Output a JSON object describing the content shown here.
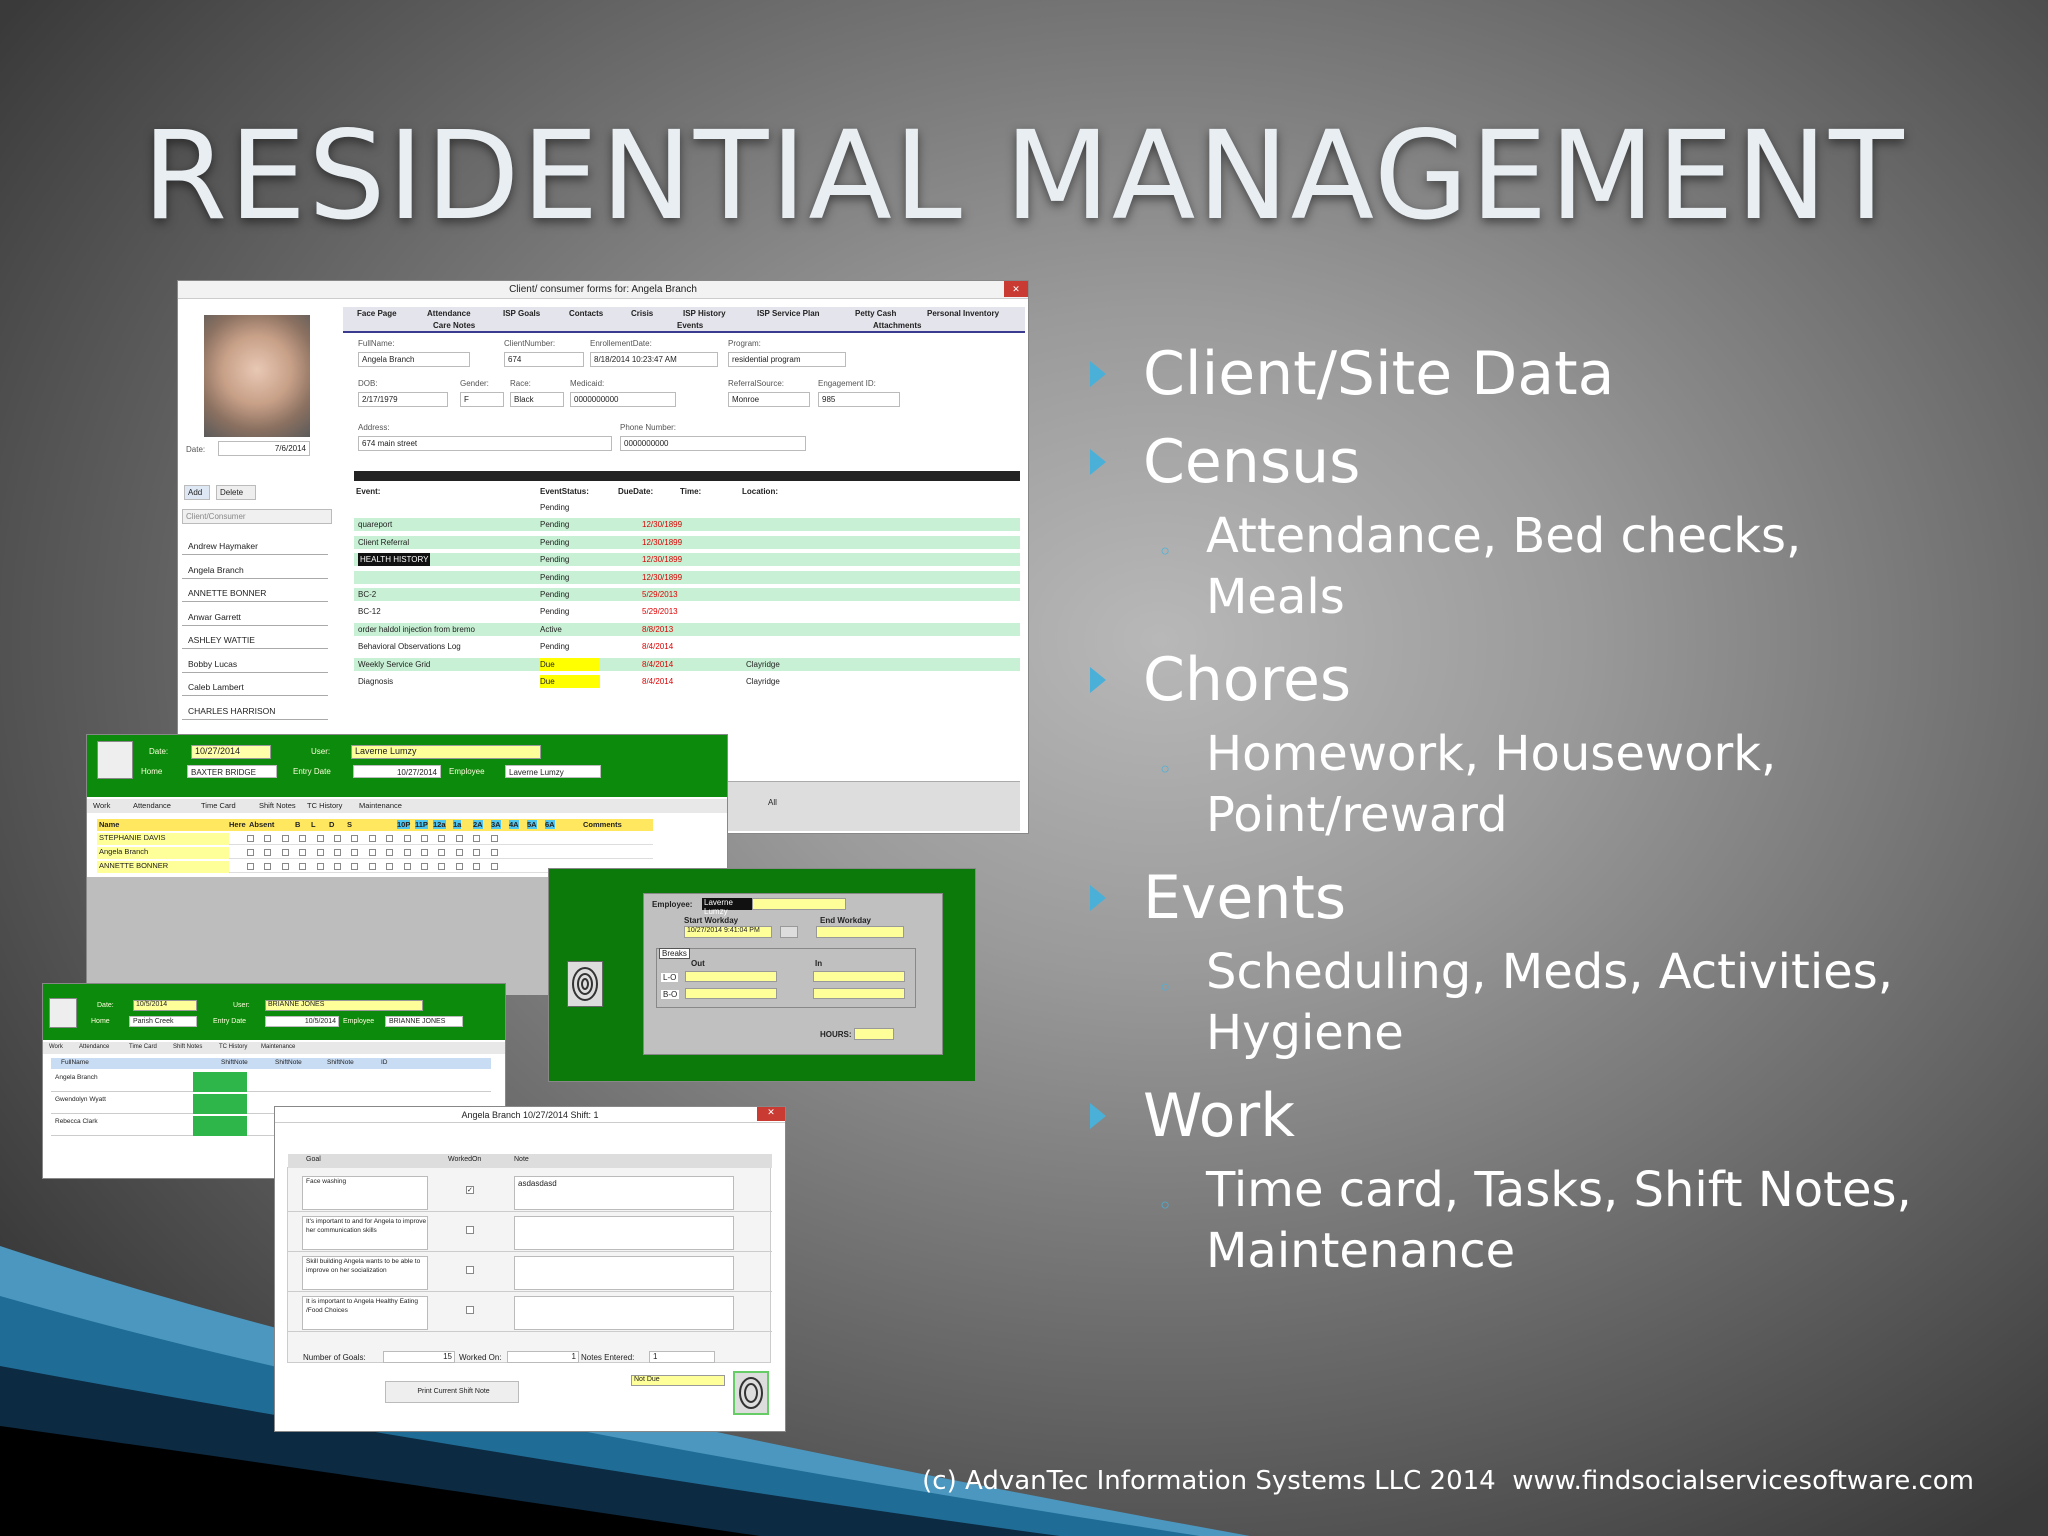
{
  "slide": {
    "title": "RESIDENTIAL MANAGEMENT",
    "footer": "(c) AdvanTec Information Systems LLC 2014  www.findsocialservicesoftware.com"
  },
  "bullets": [
    {
      "label": "Client/Site Data",
      "subs": []
    },
    {
      "label": "Census",
      "subs": [
        "Attendance, Bed checks, Meals"
      ]
    },
    {
      "label": "Chores",
      "subs": [
        "Homework, Housework, Point/reward"
      ]
    },
    {
      "label": "Events",
      "subs": [
        "Scheduling, Meds, Activities, Hygiene"
      ]
    },
    {
      "label": "Work",
      "subs": [
        "Time card, Tasks, Shift Notes, Maintenance"
      ]
    }
  ],
  "colors": {
    "bullet_arrow": "#4ab0d8",
    "title": "#e8eef2",
    "green": "#0c8a0c"
  },
  "client_form": {
    "title": "Client/ consumer forms for:  Angela Branch",
    "tabs": [
      "Face Page",
      "Attendance",
      "ISP Goals",
      "Contacts",
      "Crisis",
      "ISP History",
      "ISP Service Plan",
      "Petty Cash",
      "Personal Inventory",
      "Care Notes",
      "Events",
      "Attachments"
    ],
    "date_label": "Date:",
    "date_value": "7/6/2014",
    "add": "Add",
    "delete": "Delete",
    "list_header": "Client/Consumer",
    "clients": [
      "Andrew Haymaker",
      "Angela Branch",
      "ANNETTE BONNER",
      "Anwar Garrett",
      "ASHLEY WATTIE",
      "Bobby Lucas",
      "Caleb Lambert",
      "CHARLES HARRISON"
    ],
    "labels": {
      "fullname": "FullName:",
      "clientnumber": "ClientNumber:",
      "enrollment": "EnrollementDate:",
      "program": "Program:",
      "dob": "DOB:",
      "gender": "Gender:",
      "race": "Race:",
      "medicaid": "Medicaid:",
      "referral": "ReferralSource:",
      "engagement": "Engagement ID:",
      "address": "Address:",
      "phone": "Phone Number:"
    },
    "values": {
      "fullname": "Angela Branch",
      "clientnumber": "674",
      "enrollment": "8/18/2014 10:23:47 AM",
      "program": "residential program",
      "dob": "2/17/1979",
      "gender": "F",
      "race": "Black",
      "medicaid": "0000000000",
      "referral": "Monroe",
      "engagement": "985",
      "address": "674 main street",
      "phone": "0000000000"
    },
    "event_headers": [
      "Event:",
      "EventStatus:",
      "DueDate:",
      "Time:",
      "Location:"
    ],
    "events": [
      {
        "event": "",
        "status": "Pending",
        "due": "",
        "loc": ""
      },
      {
        "event": "quareport",
        "status": "Pending",
        "due": "12/30/1899",
        "loc": ""
      },
      {
        "event": "Client Referral",
        "status": "Pending",
        "due": "12/30/1899",
        "loc": ""
      },
      {
        "event": "HEALTH HISTORY",
        "status": "Pending",
        "due": "12/30/1899",
        "loc": ""
      },
      {
        "event": "",
        "status": "Pending",
        "due": "12/30/1899",
        "loc": ""
      },
      {
        "event": "BC-2",
        "status": "Pending",
        "due": "5/29/2013",
        "loc": ""
      },
      {
        "event": "BC-12",
        "status": "Pending",
        "due": "5/29/2013",
        "loc": ""
      },
      {
        "event": "order haldol injection from bremo",
        "status": "Active",
        "due": "8/8/2013",
        "loc": ""
      },
      {
        "event": "Behavioral Observations Log",
        "status": "Pending",
        "due": "8/4/2014",
        "loc": ""
      },
      {
        "event": "Weekly Service Grid",
        "status": "Due",
        "due": "8/4/2014",
        "loc": "Clayridge"
      },
      {
        "event": "Diagnosis",
        "status": "Due",
        "due": "8/4/2014",
        "loc": "Clayridge"
      }
    ],
    "all": "All"
  },
  "attendance": {
    "date_label": "Date:",
    "date": "10/27/2014",
    "user_label": "User:",
    "user": "Laverne Lumzy",
    "home_label": "Home",
    "home": "BAXTER BRIDGE",
    "entry_label": "Entry Date",
    "entry": "10/27/2014",
    "employee_label": "Employee",
    "employee": "Laverne Lumzy",
    "tabs": [
      "Work",
      "Attendance",
      "Time Card",
      "Shift Notes",
      "TC History",
      "Maintenance"
    ],
    "cols": [
      "Name",
      "Here",
      "Absent",
      "B",
      "L",
      "D",
      "S",
      "10P",
      "11P",
      "12a",
      "1a",
      "2A",
      "3A",
      "4A",
      "5A",
      "6A",
      "Comments"
    ],
    "rows": [
      "STEPHANIE DAVIS",
      "Angela Branch",
      "ANNETTE BONNER"
    ]
  },
  "timecard": {
    "employee_label": "Employee:",
    "employee": "Laverne Lumzy",
    "start": "Start Workday",
    "end": "End Workday",
    "start_val": "10/27/2014 9:41:04 PM",
    "breaks": "Breaks",
    "out": "Out",
    "in": "In",
    "r1": "L-O",
    "r2": "B-O",
    "hours": "HOURS:"
  },
  "shiftnotes_list": {
    "date_label": "Date:",
    "date": "10/5/2014",
    "user_label": "User:",
    "user": "BRIANNE JONES",
    "home_label": "Home",
    "home": "Parish Creek",
    "entry_label": "Entry Date",
    "entry": "10/5/2014",
    "employee_label": "Employee",
    "employee": "BRIANNE JONES",
    "tabs": [
      "Work",
      "Attendance",
      "Time Card",
      "Shift Notes",
      "TC History",
      "Maintenance"
    ],
    "cols": [
      "FullName",
      "ShiftNote",
      "ShiftNote",
      "ShiftNote",
      "ID"
    ],
    "rows": [
      "Angela Branch",
      "Gwendolyn Wyatt",
      "Rebecca Clark"
    ]
  },
  "shift_note": {
    "title": "Angela Branch 10/27/2014 Shift: 1",
    "cols": [
      "Goal",
      "WorkedOn",
      "Note"
    ],
    "goals": [
      "Face washing",
      "It's important to and for Angela to improve her communication skills",
      "Skill building Angela wants to be able to improve on her socialization",
      "It is important to Angela Healthy Eating /Food Choices"
    ],
    "note1": "asdasdasd",
    "num_goals_label": "Number of Goals:",
    "num_goals": "15",
    "worked_label": "Worked On:",
    "worked": "1",
    "notes_label": "Notes Entered:",
    "notes": "1",
    "print": "Print Current Shift Note",
    "status": "Not Due"
  }
}
